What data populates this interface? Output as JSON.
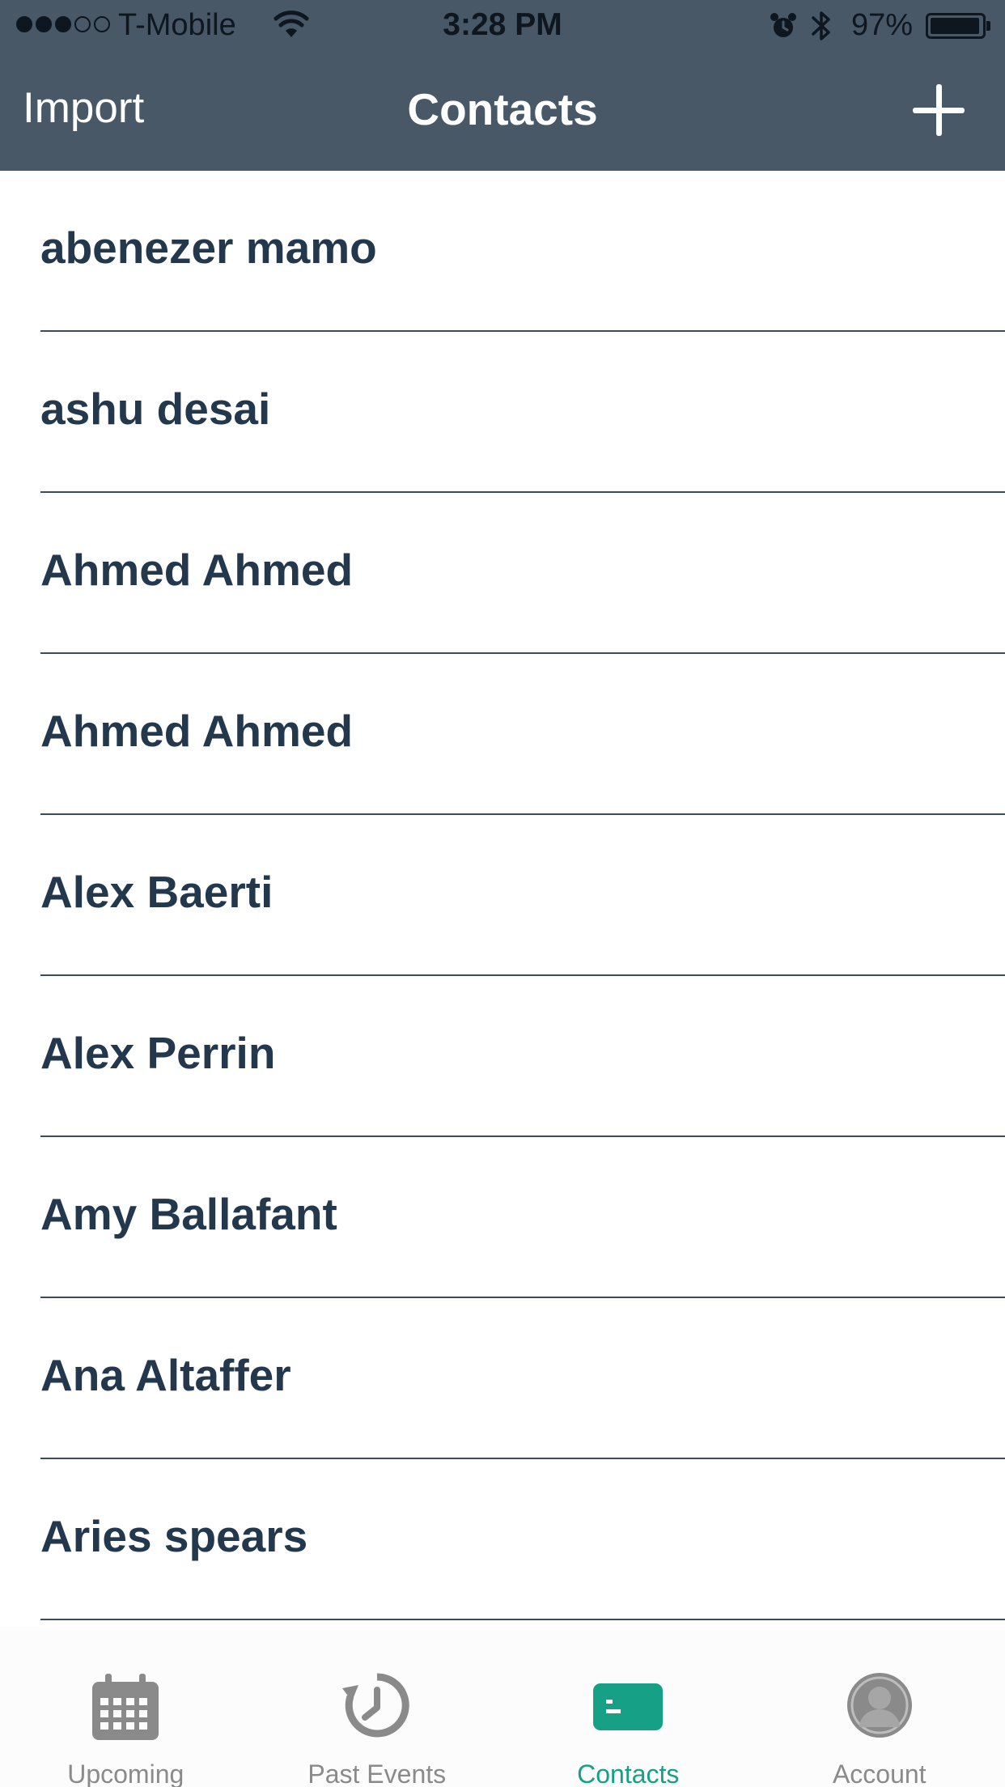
{
  "status_bar": {
    "carrier": "T-Mobile",
    "time": "3:28 PM",
    "battery_percent": "97%",
    "battery_level": 0.97,
    "signal_bars_filled": 3,
    "signal_bars_total": 5
  },
  "nav": {
    "left_label": "Import",
    "title": "Contacts",
    "right_icon": "plus-icon"
  },
  "contacts": [
    {
      "name": "abenezer mamo"
    },
    {
      "name": "ashu desai"
    },
    {
      "name": "Ahmed Ahmed"
    },
    {
      "name": "Ahmed Ahmed"
    },
    {
      "name": "Alex Baerti"
    },
    {
      "name": "Alex Perrin"
    },
    {
      "name": "Amy Ballafant"
    },
    {
      "name": "Ana Altaffer"
    },
    {
      "name": "Aries spears"
    }
  ],
  "tabs": [
    {
      "label": "Upcoming",
      "icon": "calendar-icon",
      "active": false
    },
    {
      "label": "Past Events",
      "icon": "history-clock-icon",
      "active": false
    },
    {
      "label": "Contacts",
      "icon": "contact-card-icon",
      "active": true
    },
    {
      "label": "Account",
      "icon": "account-icon",
      "active": false
    }
  ],
  "colors": {
    "header_bg": "#485866",
    "contact_text": "#24384d",
    "active_tab": "#16a085",
    "inactive_tab": "#8a8a8a"
  }
}
